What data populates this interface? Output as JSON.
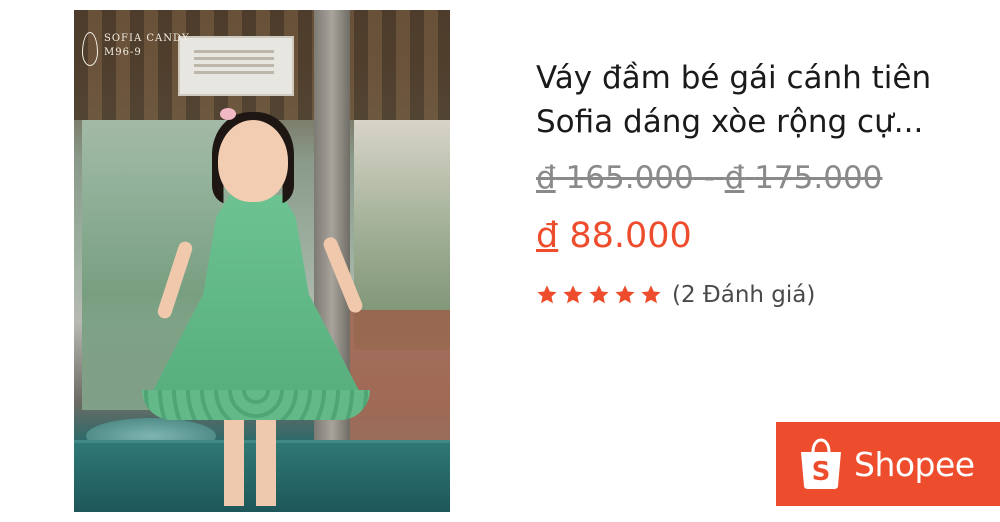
{
  "product": {
    "title": "Váy đầm bé gái cánh tiên Sofia dáng xòe rộng cự...",
    "currency_symbol": "đ",
    "original_price_min": "165.000",
    "original_price_separator": " - ",
    "original_price_max": "175.000",
    "sale_price": "88.000",
    "rating_stars": 5,
    "review_count_text": "(2 Đánh giá)"
  },
  "image": {
    "watermark_line1": "SOFIA CANDY",
    "watermark_line2": "M96-9"
  },
  "brand": {
    "name": "Shopee",
    "logo_icon": "shopping-bag-icon",
    "color": "#ee4d2d"
  },
  "colors": {
    "sale_price": "#ee4d2d",
    "star": "#ee4d2d",
    "old_price": "#8a8a8a"
  }
}
